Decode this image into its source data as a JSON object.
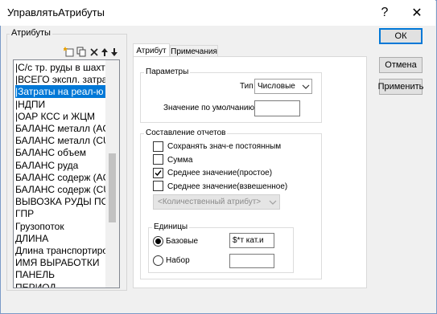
{
  "window": {
    "title": "УправлятьАтрибуты",
    "help_glyph": "?",
    "close_glyph": "✕"
  },
  "attributes_group": {
    "label": "Атрибуты",
    "items": [
      "|С/с тр. руды в шахте",
      "|ВСЕГО экспл. затрать",
      "|Затраты на реал-ю",
      "|НДПИ",
      "|ОАР КСС и ЖЦМ",
      "БАЛАНС металл (AG)",
      "БАЛАНС металл (CU)",
      "БАЛАНС объем",
      "БАЛАНС руда",
      "БАЛАНС содерж (AG)",
      "БАЛАНС содерж (CU)",
      "ВЫВОЗКА РУДЫ ПОРТ",
      "ГПР",
      "Грузопоток",
      "ДЛИНА",
      "Длина транспортиро",
      "ИМЯ ВЫРАБОТКИ",
      "ПАНЕЛЬ",
      "ПЕРИОД"
    ],
    "selected_index": 2
  },
  "tabs": {
    "attribute": "Атрибут",
    "notes": "Примечания"
  },
  "params": {
    "label": "Параметры",
    "type_label": "Тип",
    "type_value": "Числовые",
    "default_label": "Значение по умолчанию",
    "default_value": ""
  },
  "reporting": {
    "label": "Составление отчетов",
    "keep_const": "Сохранять знач-е постоянным",
    "keep_const_checked": false,
    "sum": "Сумма",
    "sum_checked": false,
    "avg_simple": "Среднее значение(простое)",
    "avg_simple_checked": true,
    "avg_weighted": "Среднее значение(взвешенное)",
    "avg_weighted_checked": false,
    "qty_attr_placeholder": "<Количественный атрибут>"
  },
  "units": {
    "label": "Единицы",
    "base_label": "Базовые",
    "base_value": "$*т кат.и",
    "set_label": "Набор",
    "set_value": "",
    "selected": "base"
  },
  "buttons": {
    "ok": "ОК",
    "cancel": "Отмена",
    "apply": "Применить"
  },
  "colors": {
    "selection": "#0078d7",
    "check": "#000000"
  }
}
